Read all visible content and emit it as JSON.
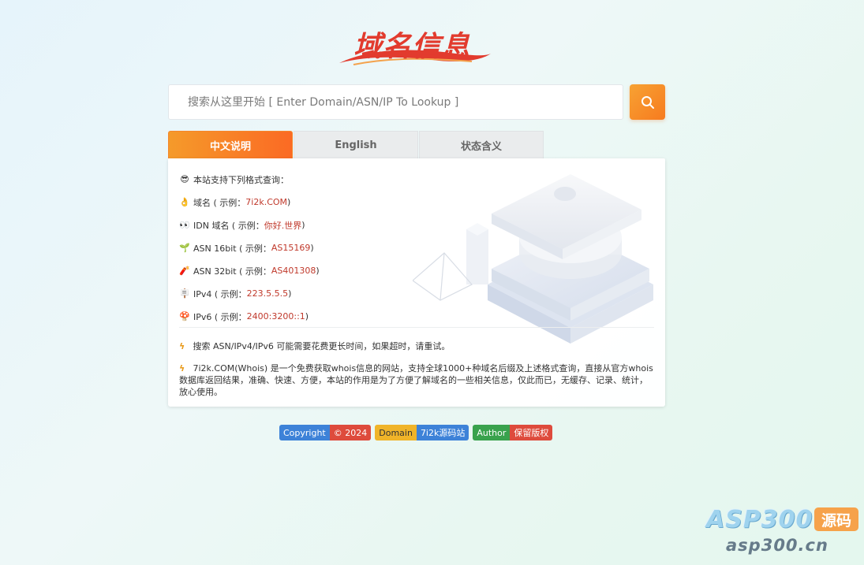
{
  "logo": {
    "text": "域名信息"
  },
  "search": {
    "placeholder": "搜索从这里开始 [ Enter Domain/ASN/IP To Lookup ]",
    "button_icon": "search-icon"
  },
  "tabs": [
    {
      "label": "中文说明",
      "active": true
    },
    {
      "label": "English",
      "active": false
    },
    {
      "label": "状态含义",
      "active": false
    }
  ],
  "panel": {
    "intro": {
      "icon": "😎",
      "text": "本站支持下列格式查询："
    },
    "items": [
      {
        "icon": "👌",
        "label": "域名 ( 示例：",
        "example": "7i2k.COM",
        "suffix": " )"
      },
      {
        "icon": "👀",
        "label": "IDN 域名 ( 示例：",
        "example": "你好.世界",
        "suffix": " )"
      },
      {
        "icon": "🌱",
        "label": "ASN 16bit ( 示例：",
        "example": "AS15169",
        "suffix": " )"
      },
      {
        "icon": "🧨",
        "label": "ASN 32bit ( 示例：",
        "example": "AS401308",
        "suffix": " )"
      },
      {
        "icon": "🪧",
        "label": "IPv4 ( 示例：",
        "example": "223.5.5.5",
        "suffix": " )"
      },
      {
        "icon": "🍄",
        "label": "IPv6 ( 示例：",
        "example": "2400:3200::1",
        "suffix": " )"
      }
    ],
    "note1": "搜索 ASN/IPv4/IPv6 可能需要花费更长时间，如果超时，请重试。",
    "note2": "7i2k.COM(Whois) 是一个免费获取whois信息的网站，支持全球1000+种域名后缀及上述格式查询，直接从官方whois数据库返回结果，准确、快速、方便，本站的作用是为了方便了解域名的一些相关信息，仅此而已，无缓存、记录、统计，放心使用。"
  },
  "badges": [
    {
      "left": "Copyright",
      "right": "© 2024"
    },
    {
      "left": "Domain",
      "right": "7i2k源码站"
    },
    {
      "left": "Author",
      "right": "保留版权"
    }
  ],
  "watermark": {
    "big": "ASP300",
    "tag": "源码",
    "small": "asp300.cn"
  },
  "colors": {
    "accent": "#f77b1f",
    "example_red": "#c0392b"
  }
}
